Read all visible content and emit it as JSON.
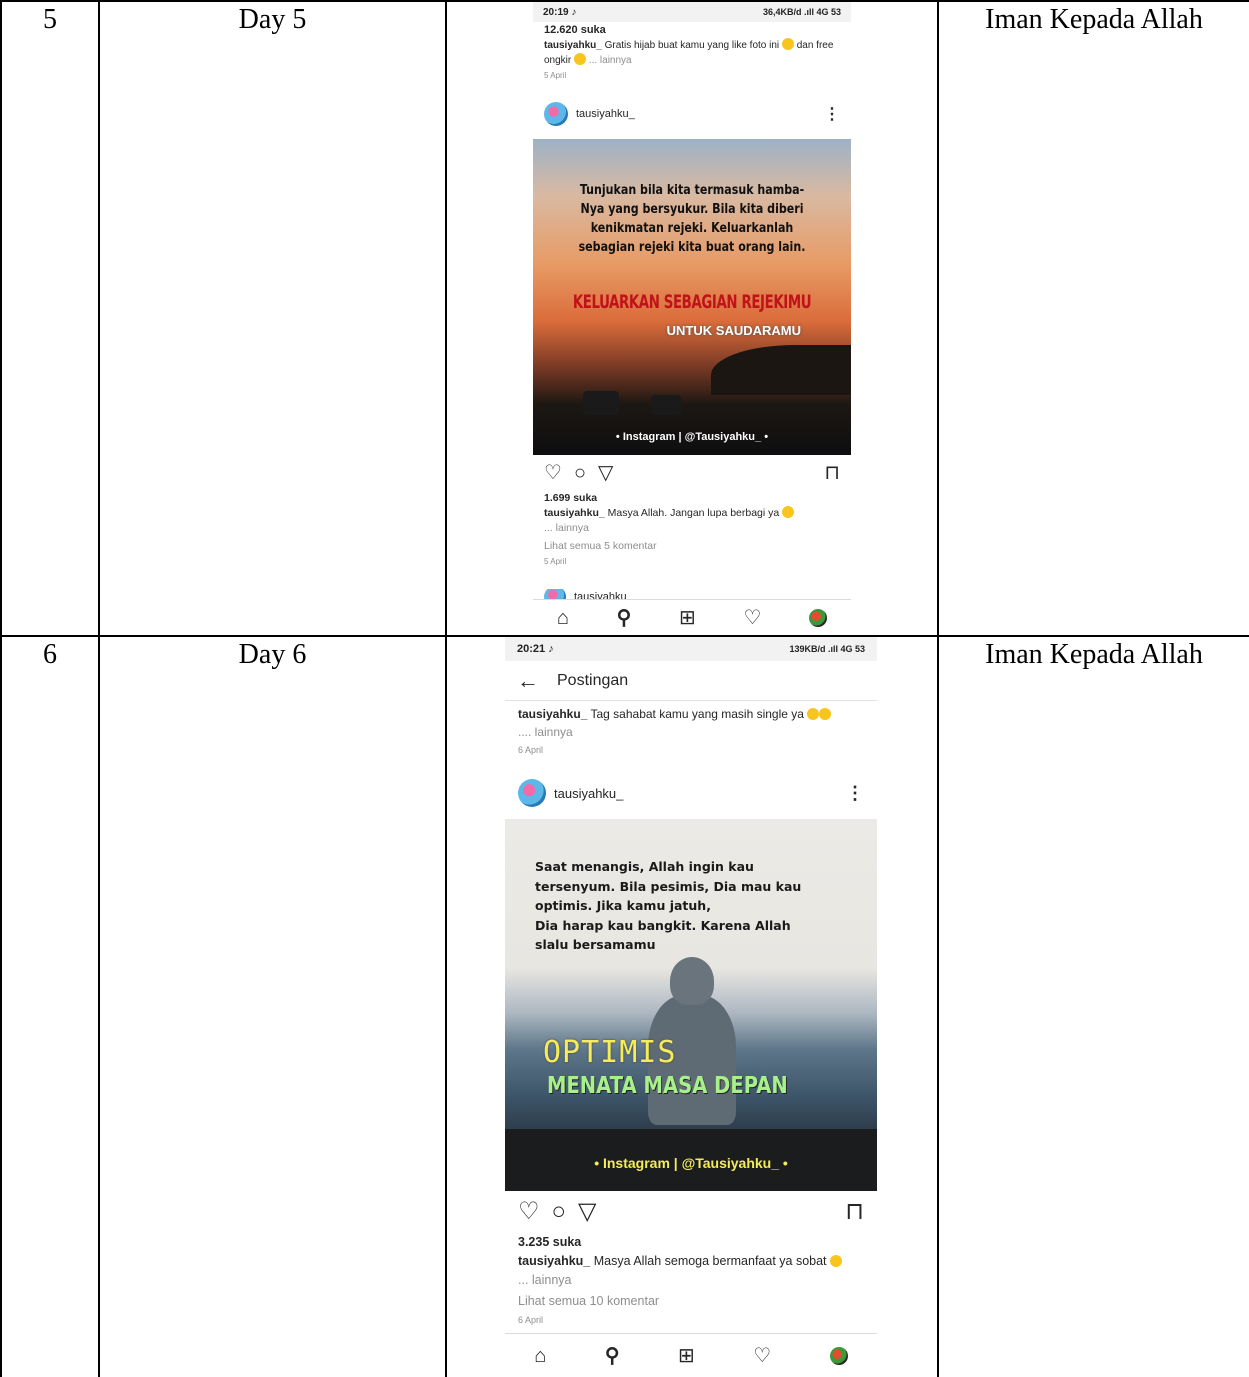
{
  "rows": [
    {
      "no": "5",
      "day": "Day 5",
      "theme": "Iman Kepada Allah",
      "phone": {
        "status_time": "20:19",
        "status_right": "36,4KB/d  .ıll 4G  53",
        "top_likes": "12.620 suka",
        "top_user": "tausiyahku_",
        "top_caption": "Gratis hijab buat kamu yang like foto ini",
        "top_caption_2": "dan free ongkir",
        "top_more": "... lainnya",
        "top_date": "5 April",
        "username": "tausiyahku_",
        "post_quote": "Tunjukan bila kita termasuk hamba-Nya yang bersyukur. Bila kita diberi kenikmatan rejeki. Keluarkanlah sebagian rejeki kita buat orang lain.",
        "post_heading": "KELUARKAN SEBAGIAN REJEKIMU",
        "post_sub": "UNTUK SAUDARAMU",
        "post_ig": "• Instagram | @Tausiyahku_ •",
        "likes": "1.699 suka",
        "caption_user": "tausiyahku_",
        "caption": "Masya Allah. Jangan lupa berbagi ya",
        "more": "... lainnya",
        "comments": "Lihat semua 5 komentar",
        "date": "5 April",
        "next_user": "tausiyahku_"
      }
    },
    {
      "no": "6",
      "day": "Day 6",
      "theme": "Iman Kepada Allah",
      "phone": {
        "status_time": "20:21",
        "status_right": "139KB/d  .ıll 4G  53",
        "header_title": "Postingan",
        "top_user": "tausiyahku_",
        "top_caption": "Tag sahabat kamu yang masih single ya",
        "top_more": ".... lainnya",
        "top_date": "6 April",
        "username": "tausiyahku_",
        "post_quote_lines": [
          "Saat menangis, Allah ingin kau",
          "tersenyum. Bila pesimis, Dia mau kau",
          "optimis. Jika kamu jatuh,",
          "Dia harap kau bangkit. Karena Allah",
          "slalu bersamamu"
        ],
        "post_heading": "OPTIMIS",
        "post_sub": "MENATA MASA DEPAN",
        "post_ig": "• Instagram | @Tausiyahku_ •",
        "likes": "3.235 suka",
        "caption_user": "tausiyahku_",
        "caption": "Masya Allah semoga bermanfaat ya sobat",
        "more": "... lainnya",
        "comments": "Lihat semua 10 komentar",
        "date": "6 April"
      }
    }
  ],
  "icons": {
    "heart": "♡",
    "comment": "○",
    "share": "▽",
    "bookmark": "⊓",
    "home": "⌂",
    "search": "⚲",
    "add": "⊞",
    "activity": "♡",
    "back": "←",
    "more": "⋮",
    "tiktok": "♪"
  }
}
